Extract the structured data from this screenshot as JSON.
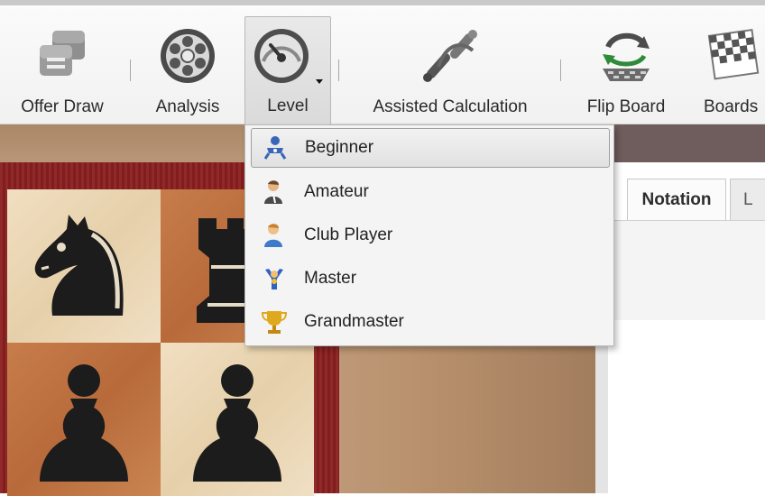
{
  "toolbar": {
    "items": [
      {
        "label": "Offer Draw",
        "icon": "offer-draw-icon"
      },
      {
        "label": "Analysis",
        "icon": "analysis-icon"
      },
      {
        "label": "Level",
        "icon": "level-gauge-icon"
      },
      {
        "label": "Assisted Calculation",
        "icon": "assisted-calculation-icon"
      },
      {
        "label": "Flip Board",
        "icon": "flip-board-icon"
      },
      {
        "label": "Boards",
        "icon": "boards-icon"
      }
    ]
  },
  "level_menu": {
    "items": [
      {
        "label": "Beginner",
        "icon": "baby-icon",
        "selected": true
      },
      {
        "label": "Amateur",
        "icon": "amateur-player-icon",
        "selected": false
      },
      {
        "label": "Club Player",
        "icon": "club-player-icon",
        "selected": false
      },
      {
        "label": "Master",
        "icon": "master-icon",
        "selected": false
      },
      {
        "label": "Grandmaster",
        "icon": "trophy-icon",
        "selected": false
      }
    ]
  },
  "panel": {
    "tabs": [
      {
        "label": "Notation"
      },
      {
        "label": "L"
      }
    ]
  },
  "colors": {
    "board_frame": "#8a1f1f",
    "light_square": "#eedcbd",
    "dark_square": "#c07444",
    "menu_bg": "#f4f4f4"
  }
}
